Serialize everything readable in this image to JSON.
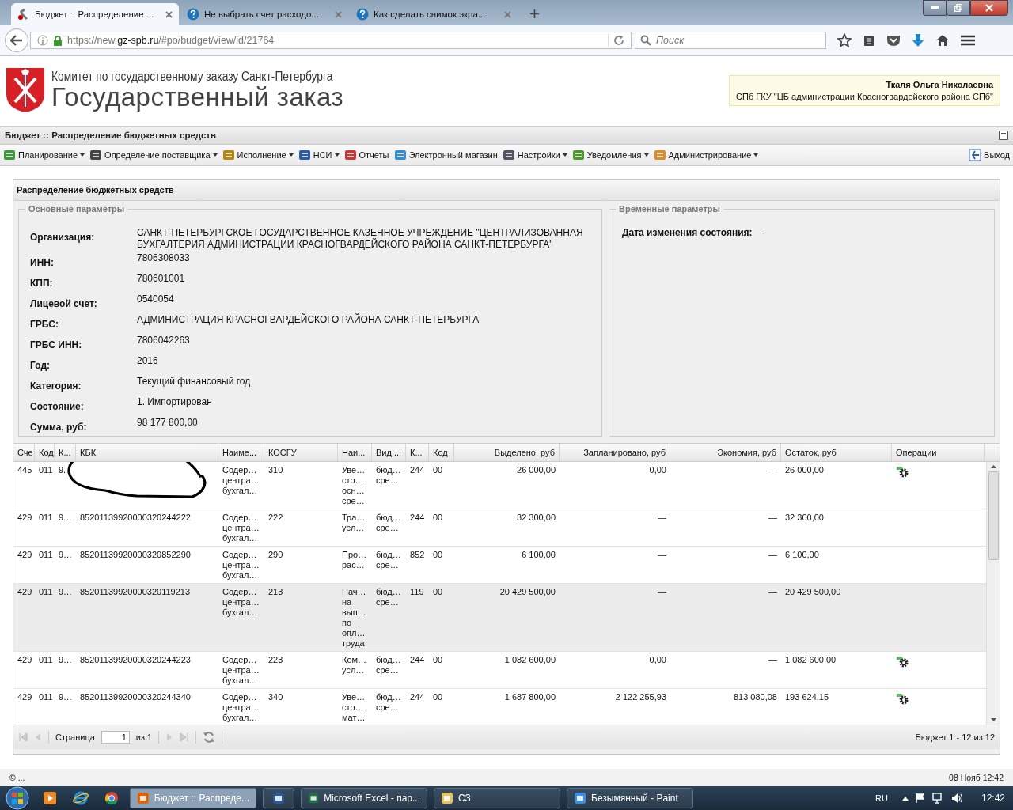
{
  "browser": {
    "tabs": [
      {
        "title": "Бюджет :: Распределение ...",
        "selected": true
      },
      {
        "title": "Не выбрать счет расходо...",
        "selected": false
      },
      {
        "title": "Как сделать снимок экра...",
        "selected": false
      }
    ],
    "url": "https://new.**gz-spb.ru**/#po/budget/view/id/21764",
    "search_placeholder": "Поиск"
  },
  "header": {
    "org": "Комитет по государственному заказу Санкт-Петербурга",
    "title": "Государственный заказ",
    "user_name": "Ткаля Ольга Николаевна",
    "user_org": "СПб ГКУ \"ЦБ администрации Красногвардейского района СПб\""
  },
  "panel_title": "Бюджет :: Распределение бюджетных средств",
  "menu": [
    {
      "label": "Планирование",
      "dropdown": true
    },
    {
      "label": "Определение поставщика",
      "dropdown": true
    },
    {
      "label": "Исполнение",
      "dropdown": true
    },
    {
      "label": "НСИ",
      "dropdown": true
    },
    {
      "label": "Отчеты",
      "dropdown": false
    },
    {
      "label": "Электронный магазин",
      "dropdown": false
    },
    {
      "label": "Настройки",
      "dropdown": true
    },
    {
      "label": "Уведомления",
      "dropdown": true
    },
    {
      "label": "Администрирование",
      "dropdown": true
    }
  ],
  "logout": "Выход",
  "section_title": "Распределение бюджетных средств",
  "main_params": {
    "legend": "Основные параметры",
    "fields": [
      {
        "label": "Организация:",
        "value": "САНКТ-ПЕТЕРБУРГСКОЕ ГОСУДАРСТВЕННОЕ КАЗЕННОЕ УЧРЕЖДЕНИЕ \"ЦЕНТРАЛИЗОВАННАЯ БУХГАЛТЕРИЯ АДМИНИСТРАЦИИ КРАСНОГВАРДЕЙСКОГО РАЙОНА САНКТ-ПЕТЕРБУРГА\""
      },
      {
        "label": "ИНН:",
        "value": "7806308033"
      },
      {
        "label": "КПП:",
        "value": "780601001"
      },
      {
        "label": "Лицевой счет:",
        "value": "0540054"
      },
      {
        "label": "ГРБС:",
        "value": "АДМИНИСТРАЦИЯ КРАСНОГВАРДЕЙСКОГО РАЙОНА САНКТ-ПЕТЕРБУРГА"
      },
      {
        "label": "ГРБС ИНН:",
        "value": "7806042263"
      },
      {
        "label": "Год:",
        "value": "2016"
      },
      {
        "label": "Категория:",
        "value": "Текущий финансовый год"
      },
      {
        "label": "Состояние:",
        "value": "1. Импортирован"
      },
      {
        "label": "Сумма, руб:",
        "value": "98 177 800,00"
      }
    ]
  },
  "temp_params": {
    "legend": "Временные параметры",
    "fields": [
      {
        "label": "Дата изменения состояния:",
        "value": "-"
      }
    ]
  },
  "table": {
    "columns": [
      "Сче",
      "Код",
      "К...",
      "КБК",
      "Наиме...",
      "КОСГУ",
      "Наи...",
      "Вид ...",
      "К...",
      "Код",
      "Выделено, руб",
      "Запланировано, руб",
      "Экономия, руб",
      "Остаток, руб",
      "Операции"
    ],
    "rows": [
      {
        "cells": [
          [
            "445"
          ],
          [
            "011"
          ],
          [
            "9."
          ],
          [],
          [
            "Содер…",
            "центра…",
            "бухгал…"
          ],
          [
            "310"
          ],
          [
            "Уве…",
            "сто…",
            "осн…",
            "сре…"
          ],
          [
            "бюд…",
            "сре…"
          ],
          [
            "244"
          ],
          [
            "00"
          ],
          [
            "26 000,00"
          ],
          [
            "0,00"
          ],
          [
            "—"
          ],
          [
            "26 000,00"
          ]
        ],
        "operations": true,
        "selected": false
      },
      {
        "cells": [
          [
            "429"
          ],
          [
            "011"
          ],
          [
            "9…"
          ],
          [
            "85201139920000320244222"
          ],
          [
            "Содер…",
            "центра…",
            "бухгал…"
          ],
          [
            "222"
          ],
          [
            "Тра…",
            "усл…"
          ],
          [
            "бюд…",
            "сре…"
          ],
          [
            "244"
          ],
          [
            "00"
          ],
          [
            "32 300,00"
          ],
          [
            "—"
          ],
          [
            "—"
          ],
          [
            "32 300,00"
          ]
        ],
        "operations": false,
        "selected": false
      },
      {
        "cells": [
          [
            "429"
          ],
          [
            "011"
          ],
          [
            "9…"
          ],
          [
            "85201139920000320852290"
          ],
          [
            "Содер…",
            "центра…",
            "бухгал…"
          ],
          [
            "290"
          ],
          [
            "Про…",
            "рас…"
          ],
          [
            "бюд…",
            "сре…"
          ],
          [
            "852"
          ],
          [
            "00"
          ],
          [
            "6 100,00"
          ],
          [
            "—"
          ],
          [
            "—"
          ],
          [
            "6 100,00"
          ]
        ],
        "operations": false,
        "selected": false
      },
      {
        "cells": [
          [
            "429"
          ],
          [
            "011"
          ],
          [
            "9…"
          ],
          [
            "85201139920000320119213"
          ],
          [
            "Содер…",
            "центра…",
            "бухгал…"
          ],
          [
            "213"
          ],
          [
            "Нач…",
            "на",
            "вып…",
            "по",
            "опл…",
            "труда"
          ],
          [
            "бюд…",
            "сре…"
          ],
          [
            "119"
          ],
          [
            "00"
          ],
          [
            "20 429 500,00"
          ],
          [
            "—"
          ],
          [
            "—"
          ],
          [
            "20 429 500,00"
          ]
        ],
        "operations": false,
        "selected": true
      },
      {
        "cells": [
          [
            "429"
          ],
          [
            "011"
          ],
          [
            "9…"
          ],
          [
            "85201139920000320244223"
          ],
          [
            "Содер…",
            "центра…",
            "бухгал…"
          ],
          [
            "223"
          ],
          [
            "Ком…",
            "усл…"
          ],
          [
            "бюд…",
            "сре…"
          ],
          [
            "244"
          ],
          [
            "00"
          ],
          [
            "1 082 600,00"
          ],
          [
            "0,00"
          ],
          [
            "—"
          ],
          [
            "1 082 600,00"
          ]
        ],
        "operations": true,
        "selected": false
      },
      {
        "cells": [
          [
            "429"
          ],
          [
            "011"
          ],
          [
            "9…"
          ],
          [
            "85201139920000320244340"
          ],
          [
            "Содер…",
            "центра…",
            "бухгал…"
          ],
          [
            "340"
          ],
          [
            "Уве…",
            "сто…",
            "мат…"
          ],
          [
            "бюд…",
            "сре…"
          ],
          [
            "244"
          ],
          [
            "00"
          ],
          [
            "1 687 800,00"
          ],
          [
            "2 122 255,93"
          ],
          [
            "813 080,08"
          ],
          [
            "193 624,15"
          ]
        ],
        "operations": true,
        "selected": false
      }
    ]
  },
  "pager": {
    "page_label": "Страница",
    "page": "1",
    "of": "из 1",
    "summary": "Бюджет 1 - 12 из 12"
  },
  "status_bar": {
    "left": "© ...",
    "right": "08 Нояб 12:42"
  },
  "taskbar": {
    "apps": [
      {
        "label": "Бюджет :: Распреде...",
        "selected": true
      },
      {
        "selected": false
      },
      {
        "label": "Microsoft Excel - пар...",
        "selected": false
      },
      {
        "label": "СЗ",
        "selected": false
      },
      {
        "label": "Безымянный - Paint",
        "selected": false
      }
    ],
    "lang": "RU",
    "time": "12:42"
  }
}
